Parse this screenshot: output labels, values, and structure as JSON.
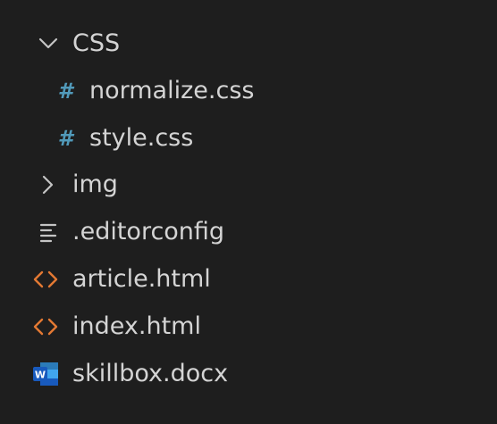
{
  "explorer": {
    "items": [
      {
        "label": "CSS",
        "icon": "chevron-down-icon",
        "type": "folder-open"
      },
      {
        "label": "normalize.css",
        "icon": "css-hash-icon",
        "type": "file"
      },
      {
        "label": "style.css",
        "icon": "css-hash-icon",
        "type": "file"
      },
      {
        "label": "img",
        "icon": "chevron-right-icon",
        "type": "folder-closed"
      },
      {
        "label": ".editorconfig",
        "icon": "lines-icon",
        "type": "file"
      },
      {
        "label": "article.html",
        "icon": "html-brackets-icon",
        "type": "file"
      },
      {
        "label": "index.html",
        "icon": "html-brackets-icon",
        "type": "file"
      },
      {
        "label": "skillbox.docx",
        "icon": "word-doc-icon",
        "type": "file"
      }
    ],
    "icon_glyphs": {
      "css_hash": "#",
      "word_letter": "W"
    }
  },
  "colors": {
    "background": "#1e1e1e",
    "text": "#d4d4d4",
    "chevron": "#c5c5c5",
    "css_icon": "#519aba",
    "html_icon": "#e37933",
    "lines_icon": "#c5c5c5",
    "word_icon": "#2b7bb9"
  }
}
